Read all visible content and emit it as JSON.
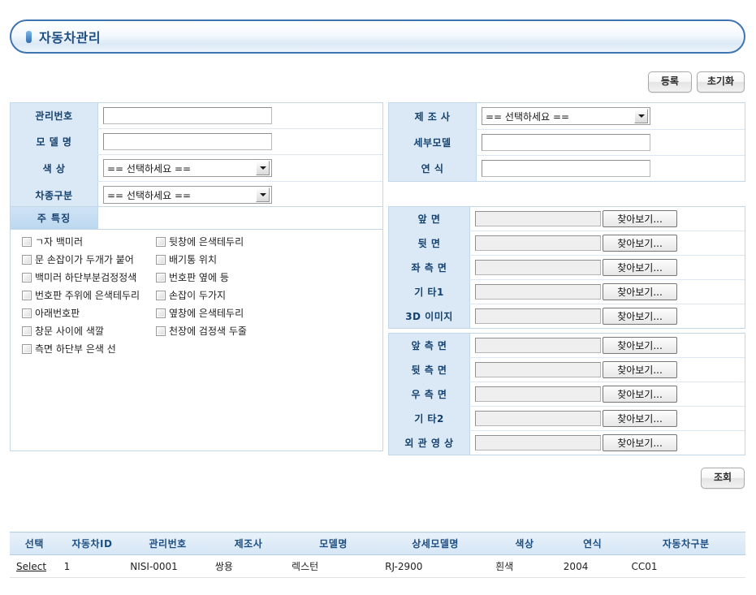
{
  "header": {
    "title": "자동차관리",
    "icon": "blue-pill-icon"
  },
  "toolbar": {
    "register_label": "등록",
    "reset_label": "초기화"
  },
  "search_button": {
    "label": "조회"
  },
  "select_placeholder": "== 선택하세요 ==",
  "browse_label": "찾아보기...",
  "left_form": {
    "rows": [
      {
        "label": "관리번호",
        "type": "text",
        "value": ""
      },
      {
        "label": "모 델 명",
        "type": "text",
        "value": ""
      },
      {
        "label": "색    상",
        "type": "select",
        "value": "== 선택하세요 =="
      },
      {
        "label": "차종구분",
        "type": "select",
        "value": "== 선택하세요 =="
      }
    ]
  },
  "right_form": {
    "rows": [
      {
        "label": "제 조 사",
        "type": "select",
        "value": "== 선택하세요 =="
      },
      {
        "label": "세부모델",
        "type": "text",
        "value": ""
      },
      {
        "label": "연    식",
        "type": "text",
        "value": ""
      }
    ]
  },
  "features": {
    "header_label": "주  특징",
    "column1": [
      {
        "label": "ㄱ자 백미러",
        "checked": false
      },
      {
        "label": "문 손잡이가 두개가 붙어",
        "checked": false
      },
      {
        "label": "백미러 하단부분검정정색",
        "checked": false
      },
      {
        "label": "번호판 주위에 은색테두리",
        "checked": false
      },
      {
        "label": "아래번호판",
        "checked": false
      },
      {
        "label": "창문 사이에 색깔",
        "checked": false
      },
      {
        "label": "측면 하단부 은색 선",
        "checked": false
      }
    ],
    "column2": [
      {
        "label": "뒷창에 은색테두리",
        "checked": false
      },
      {
        "label": "배기통 위치",
        "checked": false
      },
      {
        "label": "번호판 옆에 등",
        "checked": false
      },
      {
        "label": "손잡이 두가지",
        "checked": false
      },
      {
        "label": "옆창에 은색테두리",
        "checked": false
      },
      {
        "label": "천장에 검정색 두줄",
        "checked": false
      }
    ]
  },
  "uploads_group1": [
    {
      "label": "앞    면",
      "value": ""
    },
    {
      "label": "뒷    면",
      "value": ""
    },
    {
      "label": "좌 측 면",
      "value": ""
    },
    {
      "label": "기    타1",
      "value": ""
    },
    {
      "label": "3D 이미지",
      "value": ""
    }
  ],
  "uploads_group2": [
    {
      "label": "앞 측 면",
      "value": ""
    },
    {
      "label": "뒷 측 면",
      "value": ""
    },
    {
      "label": "우 측 면",
      "value": ""
    },
    {
      "label": "기    타2",
      "value": ""
    },
    {
      "label": "외 관 영 상",
      "value": ""
    }
  ],
  "results": {
    "columns": [
      "선택",
      "자동차ID",
      "관리번호",
      "제조사",
      "모델명",
      "상세모델명",
      "색상",
      "연식",
      "자동차구분"
    ],
    "rows": [
      {
        "select": "Select",
        "car_id": "1",
        "mgmt_no": "NISI-0001",
        "maker": "쌍용",
        "model": "렉스턴",
        "detail_model": "RJ-2900",
        "color": "흰색",
        "year": "2004",
        "car_type": "CC01"
      }
    ]
  },
  "colors": {
    "accent": "#3e74b0",
    "label_bg": "#dbe9f6",
    "title_text": "#1d4e82"
  }
}
